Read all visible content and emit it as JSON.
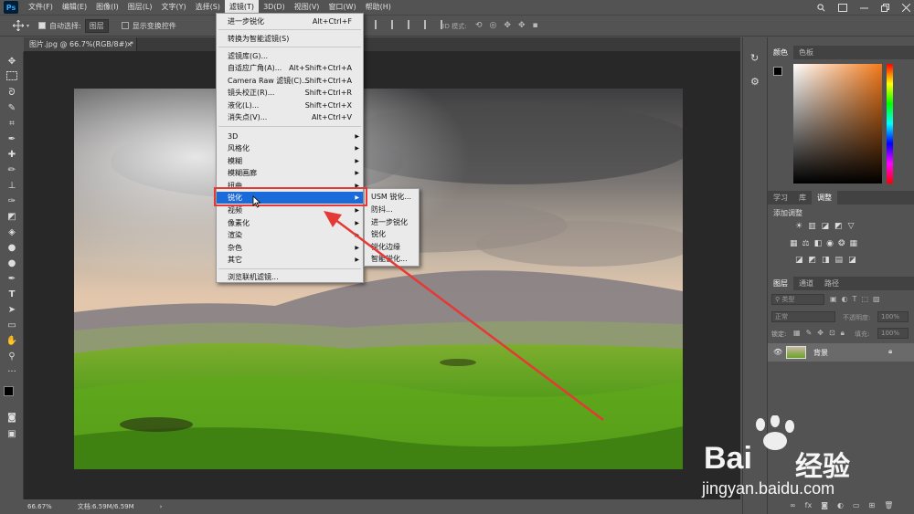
{
  "app": {
    "logo": "Ps"
  },
  "menubar": {
    "items": [
      "文件(F)",
      "编辑(E)",
      "图像(I)",
      "图层(L)",
      "文字(Y)",
      "选择(S)",
      "滤镜(T)",
      "3D(D)",
      "视图(V)",
      "窗口(W)",
      "帮助(H)"
    ],
    "active_index": 6
  },
  "options": {
    "auto_select_label": "自动选择:",
    "auto_select_value": "图层",
    "show_transform_label": "显示变换控件",
    "mode_3d_label": "3D 模式:"
  },
  "document": {
    "tab_title": "图片.jpg @ 66.7%(RGB/8#) *",
    "zoom": "66.67%",
    "doc_info": "文档:6.59M/6.59M"
  },
  "filter_menu": {
    "items": [
      {
        "label": "进一步锐化",
        "shortcut": "Alt+Ctrl+F"
      },
      {
        "label": "转换为智能滤镜(S)",
        "shortcut": ""
      },
      {
        "label": "滤镜库(G)...",
        "shortcut": ""
      },
      {
        "label": "自适应广角(A)...",
        "shortcut": "Alt+Shift+Ctrl+A"
      },
      {
        "label": "Camera Raw 滤镜(C)...",
        "shortcut": "Shift+Ctrl+A"
      },
      {
        "label": "镜头校正(R)...",
        "shortcut": "Shift+Ctrl+R"
      },
      {
        "label": "液化(L)...",
        "shortcut": "Shift+Ctrl+X"
      },
      {
        "label": "消失点(V)...",
        "shortcut": "Alt+Ctrl+V"
      },
      {
        "label": "3D",
        "shortcut": ""
      },
      {
        "label": "风格化",
        "shortcut": ""
      },
      {
        "label": "模糊",
        "shortcut": ""
      },
      {
        "label": "模糊画廊",
        "shortcut": ""
      },
      {
        "label": "扭曲",
        "shortcut": ""
      },
      {
        "label": "锐化",
        "shortcut": ""
      },
      {
        "label": "视频",
        "shortcut": ""
      },
      {
        "label": "像素化",
        "shortcut": ""
      },
      {
        "label": "渲染",
        "shortcut": ""
      },
      {
        "label": "杂色",
        "shortcut": ""
      },
      {
        "label": "其它",
        "shortcut": ""
      },
      {
        "label": "浏览联机滤镜...",
        "shortcut": ""
      }
    ],
    "highlighted_index": 13
  },
  "sharpen_submenu": {
    "items": [
      "USM 锐化...",
      "防抖...",
      "进一步锐化",
      "锐化",
      "锐化边缘",
      "智能锐化..."
    ]
  },
  "panels": {
    "color_tabs": [
      "颜色",
      "色板"
    ],
    "adjust_tabs": [
      "学习",
      "库",
      "调整"
    ],
    "adjust_title": "添加调整",
    "layer_tabs": [
      "图层",
      "通道",
      "路径"
    ],
    "layer_kind": "类型",
    "blend_mode": "正常",
    "opacity_label": "不透明度:",
    "opacity_value": "100%",
    "lock_label": "锁定:",
    "fill_label": "填充:",
    "fill_value": "100%",
    "layer_name": "背景"
  },
  "watermark": {
    "brand": "Bai",
    "brand2": "经验",
    "url": "jingyan.baidu.com"
  },
  "colors": {
    "highlight": "#1a6ad9",
    "annotation_red": "#e53935"
  }
}
